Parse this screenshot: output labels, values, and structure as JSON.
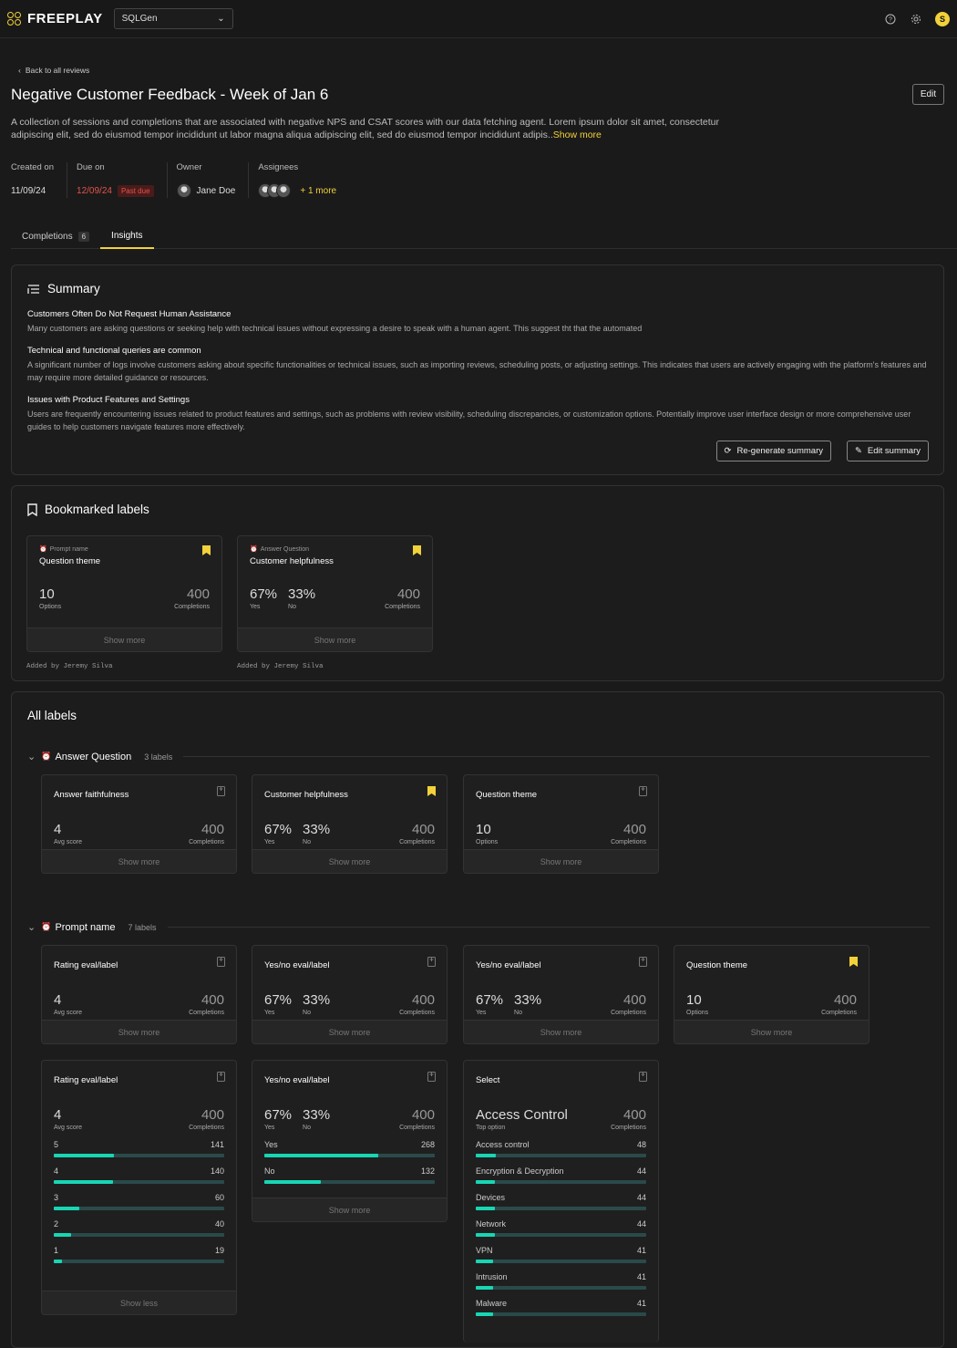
{
  "app": {
    "name": "FREEPLAY",
    "project": "SQLGen",
    "user_initial": "S"
  },
  "page": {
    "back_label": "Back to all reviews",
    "title": "Negative Customer Feedback - Week of Jan 6",
    "edit_label": "Edit",
    "description": "A collection of sessions and completions that are associated with negative NPS and CSAT scores with our data fetching agent. Lorem ipsum dolor sit amet, consectetur adipiscing elit, sed do eiusmod tempor incididunt ut labor magna aliqua adipiscing elit, sed do eiusmod tempor incididunt adipis..",
    "show_more": "Show more"
  },
  "meta": {
    "created_label": "Created on",
    "created_value": "11/09/24",
    "due_label": "Due on",
    "due_value": "12/09/24",
    "past_due": "Past due",
    "owner_label": "Owner",
    "owner_value": "Jane Doe",
    "assignees_label": "Assignees",
    "assignees_more": "+ 1 more"
  },
  "tabs": [
    {
      "label": "Completions",
      "count": "6"
    },
    {
      "label": "Insights"
    }
  ],
  "summary": {
    "title": "Summary",
    "items": [
      {
        "heading": "Customers Often Do Not Request Human Assistance",
        "text": "Many customers are asking questions or seeking help with technical issues without expressing a desire to speak with a human agent. This suggest tht that the automated"
      },
      {
        "heading": "Technical and functional queries are common",
        "text": "A significant number of logs involve customers asking about specific functionalities or technical issues, such as importing reviews, scheduling posts, or adjusting settings. This indicates that users are actively engaging with the platform's features and may require more detailed guidance or resources."
      },
      {
        "heading": "Issues with Product Features and Settings",
        "text": "Users are frequently encountering issues related to product features and settings, such as problems with review visibility, scheduling discrepancies, or customization options. Potentially improve user interface design or more comprehensive user guides to help customers navigate features more effectively."
      }
    ],
    "regen_label": "Re-generate summary",
    "edit_label": "Edit summary"
  },
  "bookmarked": {
    "title": "Bookmarked labels",
    "cards": [
      {
        "sub": "Prompt name",
        "name": "Question theme",
        "s1v": "10",
        "s1l": "Options",
        "rv": "400",
        "rl": "Completions",
        "foot": "Show more",
        "added_by": "Added by Jeremy Silva"
      },
      {
        "sub": "Answer Question",
        "name": "Customer helpfulness",
        "s1v": "67%",
        "s1l": "Yes",
        "s2v": "33%",
        "s2l": "No",
        "rv": "400",
        "rl": "Completions",
        "foot": "Show more",
        "added_by": "Added by Jeremy Silva"
      }
    ]
  },
  "all_labels": {
    "title": "All labels",
    "groups": [
      {
        "name": "Answer Question",
        "count": "3 labels"
      },
      {
        "name": "Prompt name",
        "count": "7 labels"
      }
    ],
    "aq_cards": [
      {
        "name": "Answer faithfulness",
        "s1v": "4",
        "s1l": "Avg score",
        "rv": "400",
        "rl": "Completions",
        "foot": "Show more"
      },
      {
        "name": "Customer helpfulness",
        "s1v": "67%",
        "s1l": "Yes",
        "s2v": "33%",
        "s2l": "No",
        "rv": "400",
        "rl": "Completions",
        "foot": "Show more"
      },
      {
        "name": "Question theme",
        "s1v": "10",
        "s1l": "Options",
        "rv": "400",
        "rl": "Completions",
        "foot": "Show more"
      }
    ],
    "pn_cards": [
      {
        "name": "Rating eval/label",
        "s1v": "4",
        "s1l": "Avg score",
        "rv": "400",
        "rl": "Completions",
        "foot": "Show more"
      },
      {
        "name": "Yes/no eval/label",
        "s1v": "67%",
        "s1l": "Yes",
        "s2v": "33%",
        "s2l": "No",
        "rv": "400",
        "rl": "Completions",
        "foot": "Show more"
      },
      {
        "name": "Yes/no eval/label",
        "s1v": "67%",
        "s1l": "Yes",
        "s2v": "33%",
        "s2l": "No",
        "rv": "400",
        "rl": "Completions",
        "foot": "Show more"
      },
      {
        "name": "Question theme",
        "s1v": "10",
        "s1l": "Options",
        "rv": "400",
        "rl": "Completions",
        "foot": "Show more"
      }
    ],
    "rating_card": {
      "name": "Rating eval/label",
      "s1v": "4",
      "s1l": "Avg score",
      "rv": "400",
      "rl": "Completions",
      "foot": "Show less",
      "bars": [
        {
          "label": "5",
          "value": 141
        },
        {
          "label": "4",
          "value": 140
        },
        {
          "label": "3",
          "value": 60
        },
        {
          "label": "2",
          "value": 40
        },
        {
          "label": "1",
          "value": 19
        }
      ],
      "max": 400
    },
    "yesno_card": {
      "name": "Yes/no eval/label",
      "s1v": "67%",
      "s1l": "Yes",
      "s2v": "33%",
      "s2l": "No",
      "rv": "400",
      "rl": "Completions",
      "foot": "Show more",
      "bars": [
        {
          "label": "Yes",
          "value": 268
        },
        {
          "label": "No",
          "value": 132
        }
      ],
      "max": 400
    },
    "select_card": {
      "name": "Select",
      "s1v": "Access Control",
      "s1l": "Top option",
      "rv": "400",
      "rl": "Completions",
      "bars": [
        {
          "label": "Access control",
          "value": 48
        },
        {
          "label": "Encryption & Decryption",
          "value": 44
        },
        {
          "label": "Devices",
          "value": 44
        },
        {
          "label": "Network",
          "value": 44
        },
        {
          "label": "VPN",
          "value": 41
        },
        {
          "label": "Intrusion",
          "value": 41
        },
        {
          "label": "Malware",
          "value": 41
        }
      ],
      "max": 400
    }
  },
  "colors": {
    "accent": "#f2d13a",
    "bar": "#18d6b4",
    "danger": "#e5534b"
  }
}
